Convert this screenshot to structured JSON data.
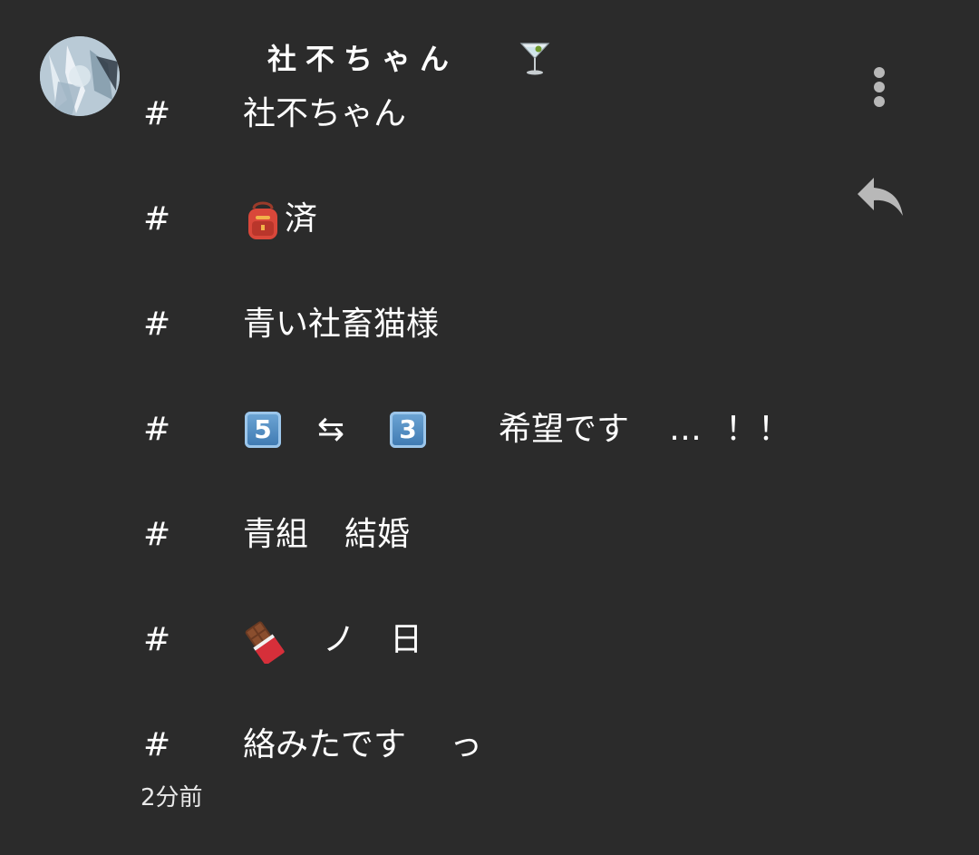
{
  "post": {
    "display_name": "社不ちゃん",
    "name_emoji": "cocktail-glass-icon",
    "hash_symbol": "#",
    "line1": "社不ちゃん",
    "line2": {
      "icon": "backpack-icon",
      "text": "済"
    },
    "line3": "青い社畜猫様",
    "line4": {
      "key_a": "5",
      "arrow": "⇆",
      "key_b": "3",
      "text": "希望です",
      "ellipsis": "…",
      "excl": "！！"
    },
    "line5": {
      "part_a": "青組",
      "part_b": "結婚"
    },
    "line6": {
      "icon": "chocolate-bar-icon",
      "part_a": "ノ",
      "part_b": "日"
    },
    "line7": {
      "part_a": "絡みたです",
      "part_b": "っ"
    },
    "timestamp": "2分前"
  },
  "actions": {
    "more_icon": "more-vertical-icon",
    "reply_icon": "reply-icon"
  },
  "colors": {
    "background": "#2b2b2b",
    "text": "#ffffff",
    "icon": "#b8b8b8"
  }
}
